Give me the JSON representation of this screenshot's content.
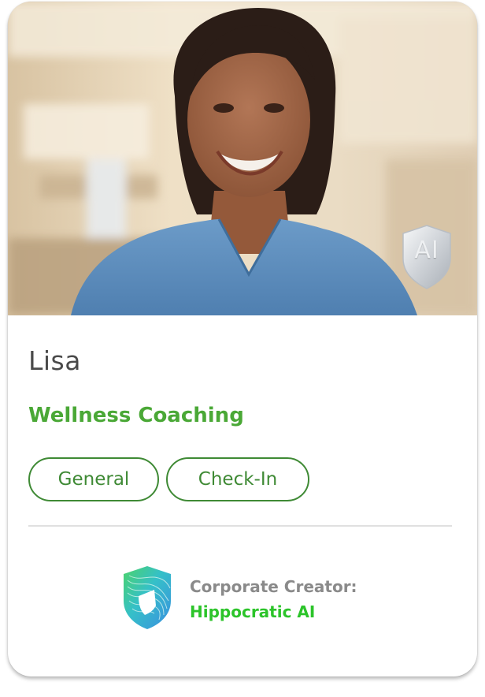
{
  "profile": {
    "name": "Lisa",
    "specialty": "Wellness Coaching",
    "badge_text": "AI",
    "photo_icon": "portrait-photo",
    "tags": [
      {
        "label": "General"
      },
      {
        "label": "Check-In"
      }
    ]
  },
  "creator": {
    "label": "Corporate Creator:",
    "name": "Hippocratic AI",
    "logo_icon": "shield-logo-icon"
  },
  "colors": {
    "accent_green": "#4aa836",
    "tag_green": "#3f8a35",
    "creator_green": "#2cc42a",
    "name_gray": "#4a4a4a",
    "label_gray": "#8a8a8a",
    "scrubs_blue": "#5f8fbf"
  }
}
